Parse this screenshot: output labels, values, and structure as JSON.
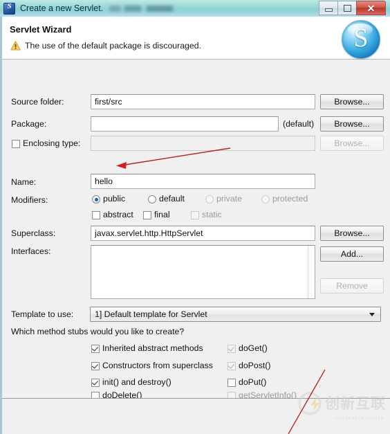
{
  "window": {
    "title": "Create a new Servlet.",
    "app_icon": "servlet-blue-s-icon",
    "buttons": {
      "minimize": "minimize-icon",
      "maximize": "maximize-icon",
      "close": "✕"
    }
  },
  "header": {
    "title": "Servlet Wizard",
    "message": "The use of the default package is discouraged.",
    "message_icon": "warning-triangle-icon",
    "banner_icon": "servlet-sphere-s-icon"
  },
  "form": {
    "source_folder": {
      "label": "Source folder:",
      "value": "first/src",
      "placeholder": "",
      "browse": "Browse..."
    },
    "package": {
      "label": "Package:",
      "value": "",
      "placeholder": "",
      "suffix": "(default)",
      "browse": "Browse..."
    },
    "enclosing_type": {
      "label": "Enclosing type:",
      "checked": false,
      "value": "",
      "browse": "Browse...",
      "disabled": true
    },
    "name": {
      "label": "Name:",
      "value": "hello",
      "placeholder": ""
    },
    "modifiers": {
      "label": "Modifiers:",
      "radios": [
        {
          "label": "public",
          "selected": true,
          "disabled": false
        },
        {
          "label": "default",
          "selected": false,
          "disabled": false
        },
        {
          "label": "private",
          "selected": false,
          "disabled": true
        },
        {
          "label": "protected",
          "selected": false,
          "disabled": true
        }
      ],
      "checks": [
        {
          "label": "abstract",
          "checked": false,
          "disabled": false
        },
        {
          "label": "final",
          "checked": false,
          "disabled": false
        },
        {
          "label": "static",
          "checked": false,
          "disabled": true
        }
      ]
    },
    "superclass": {
      "label": "Superclass:",
      "value": "javax.servlet.http.HttpServlet",
      "browse": "Browse..."
    },
    "interfaces": {
      "label": "Interfaces:",
      "items": [],
      "add": "Add...",
      "remove": "Remove",
      "remove_disabled": true
    },
    "template": {
      "label": "Template to use:",
      "value": "1] Default template for Servlet",
      "options": [
        "1] Default template for Servlet"
      ]
    },
    "stubs": {
      "question": "Which method stubs would you like to create?",
      "left": [
        {
          "label": "Inherited abstract methods",
          "checked": true,
          "disabled": false
        },
        {
          "label": "Constructors from superclass",
          "checked": true,
          "disabled": false
        },
        {
          "label": "init() and destroy()",
          "checked": true,
          "disabled": false
        },
        {
          "label": "doDelete()",
          "checked": false,
          "disabled": false
        }
      ],
      "right": [
        {
          "label": "doGet()",
          "checked": true,
          "disabled": true
        },
        {
          "label": "doPost()",
          "checked": true,
          "disabled": true
        },
        {
          "label": "doPut()",
          "checked": false,
          "disabled": false
        },
        {
          "label": "getServletInfo()",
          "checked": false,
          "disabled": true
        }
      ]
    }
  },
  "annotations": {
    "arrow_color": "#b52020",
    "arrow_to_name_field": "red-arrow-pointing-to-name-field",
    "diagonal_line": "red-diagonal-line"
  },
  "watermark": {
    "text": "创新互联",
    "subtext": "CHUANGXIN HULIAN",
    "mark": "cx-logo-icon",
    "color": "#c9c9c9"
  }
}
